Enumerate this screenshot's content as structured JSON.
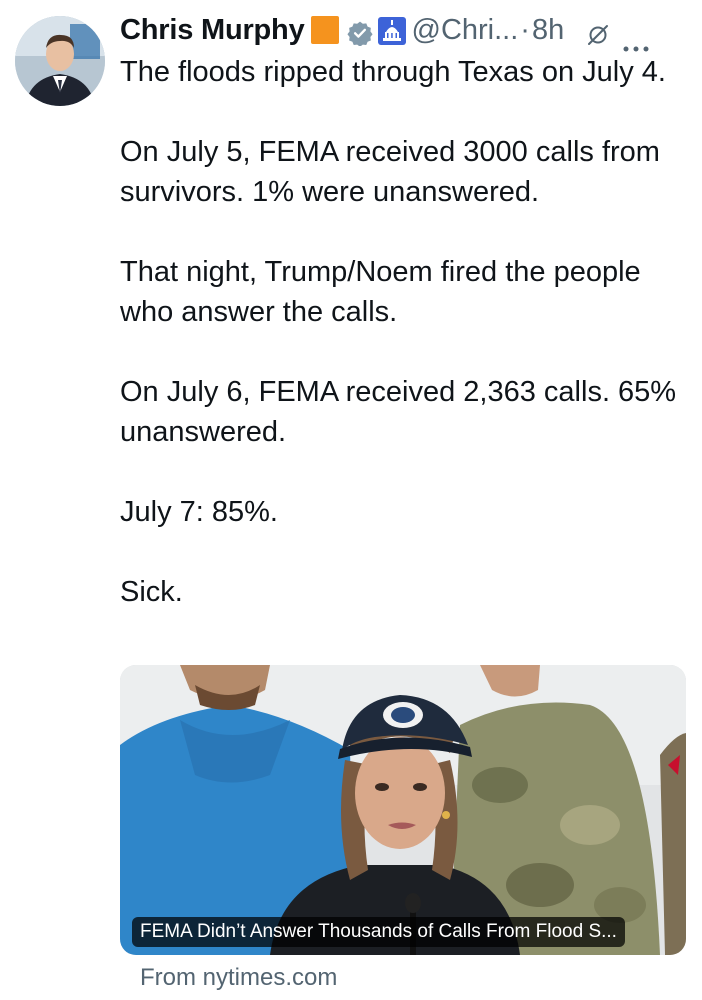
{
  "author": {
    "name": "Chris Murphy",
    "handle": "@Chri...",
    "separator": "·",
    "time": "8h"
  },
  "icons": {
    "badge": "orange-square-badge",
    "verified": "verified-gray-badge-icon",
    "affiliation": "capitol-building-icon",
    "grok": "grok-icon",
    "more": "more-options-icon"
  },
  "tweet": {
    "paragraphs": [
      "The floods ripped through Texas on July 4.",
      "On July 5, FEMA received 3000 calls from survivors. 1% were unanswered.",
      "That night, Trump/Noem fired the people who answer the calls.",
      "On July 6, FEMA received 2,363 calls. 65% unanswered.",
      "July 7: 85%.",
      "Sick."
    ]
  },
  "card": {
    "title": "FEMA Didn’t Answer Thousands of Calls From Flood S...",
    "source": "From nytimes.com"
  },
  "colors": {
    "text": "#0f1419",
    "secondary": "#536471",
    "badge_orange": "#f5931e"
  }
}
